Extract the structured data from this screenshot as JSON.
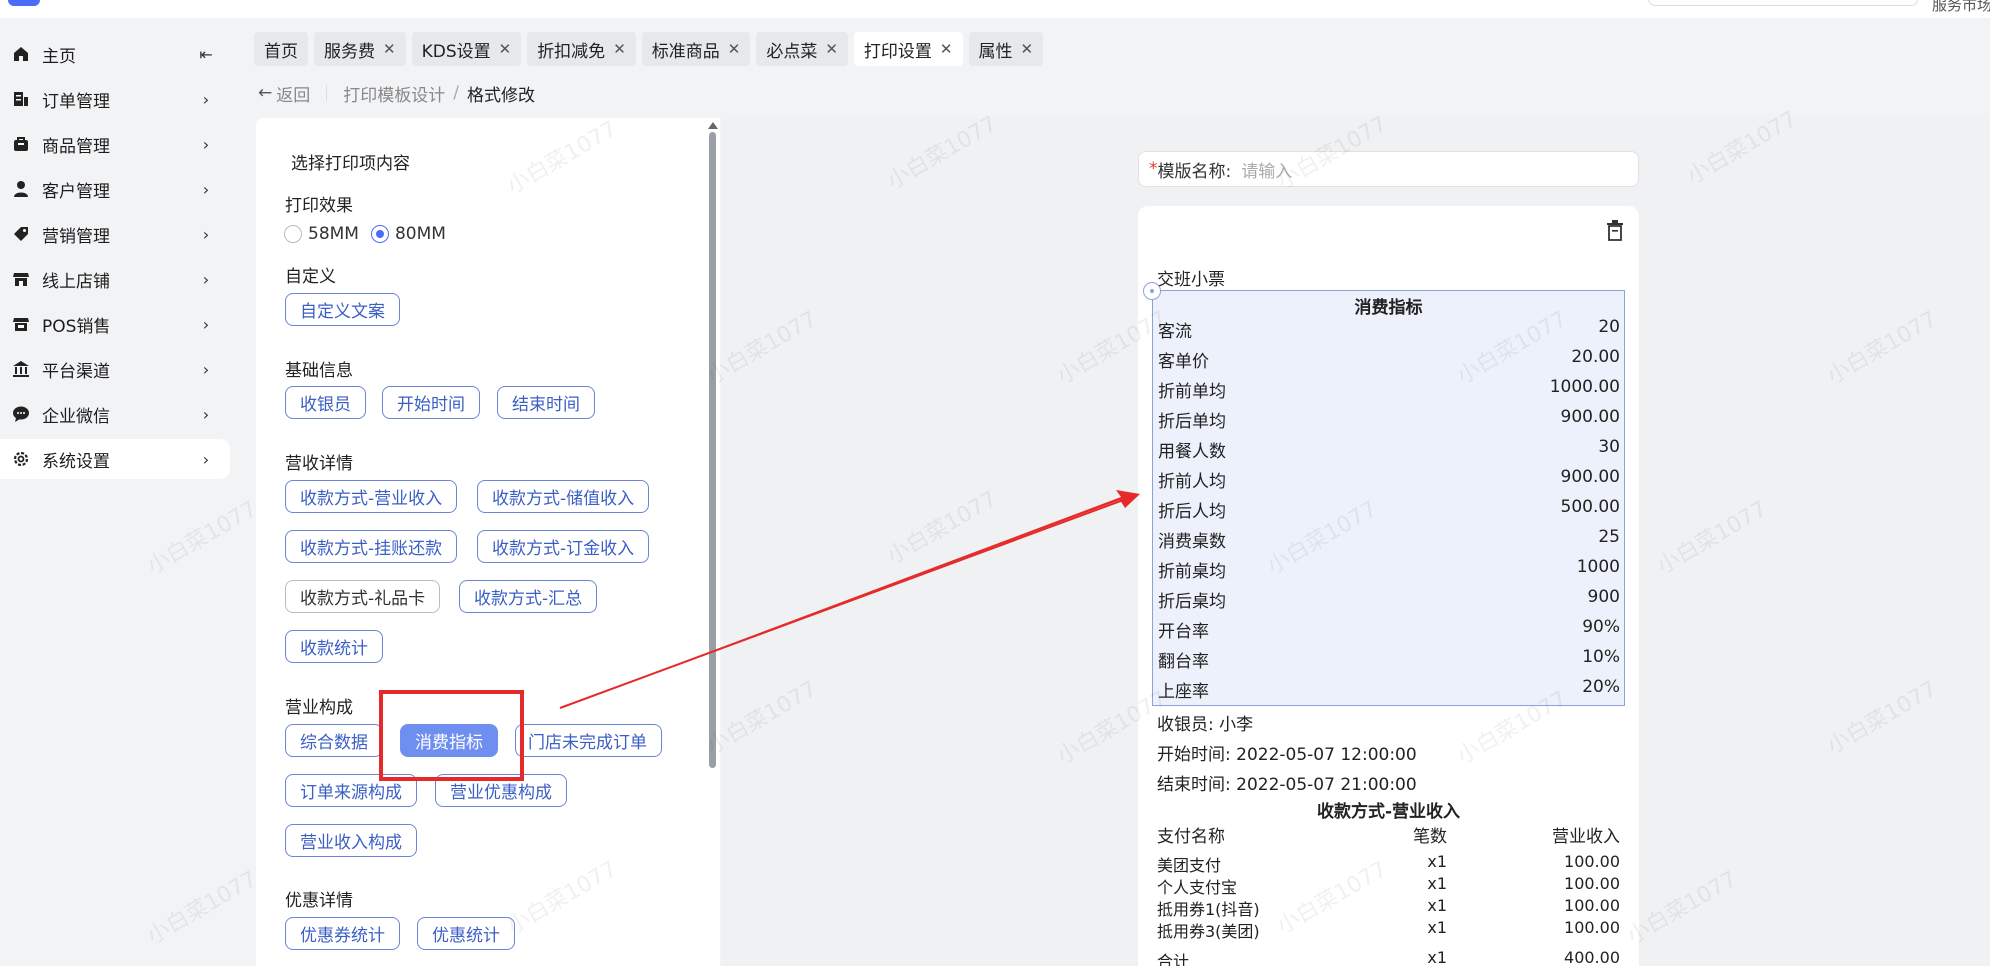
{
  "topbar": {
    "right_text": "服务市场"
  },
  "sidebar": {
    "items": [
      {
        "label": "主页",
        "icon": "home-icon"
      },
      {
        "label": "订单管理",
        "icon": "order-icon"
      },
      {
        "label": "商品管理",
        "icon": "bag-icon"
      },
      {
        "label": "客户管理",
        "icon": "user-icon"
      },
      {
        "label": "营销管理",
        "icon": "tag-icon"
      },
      {
        "label": "线上店铺",
        "icon": "store-icon"
      },
      {
        "label": "POS销售",
        "icon": "pos-icon"
      },
      {
        "label": "平台渠道",
        "icon": "bank-icon"
      },
      {
        "label": "企业微信",
        "icon": "chat-icon"
      },
      {
        "label": "系统设置",
        "icon": "gear-icon"
      }
    ],
    "collapse_icon": "collapse-icon"
  },
  "tabs": [
    {
      "label": "首页",
      "closable": false
    },
    {
      "label": "服务费",
      "closable": true
    },
    {
      "label": "KDS设置",
      "closable": true
    },
    {
      "label": "折扣减免",
      "closable": true
    },
    {
      "label": "标准商品",
      "closable": true
    },
    {
      "label": "必点菜",
      "closable": true
    },
    {
      "label": "打印设置",
      "closable": true,
      "active": true
    },
    {
      "label": "属性",
      "closable": true
    }
  ],
  "breadcrumb": {
    "back": "返回",
    "parent": "打印模板设计",
    "slash": "/",
    "current": "格式修改"
  },
  "panel": {
    "title": "选择打印项内容",
    "print_effect": {
      "label": "打印效果",
      "options": [
        "58MM",
        "80MM"
      ],
      "selected": "80MM"
    },
    "custom": {
      "label": "自定义",
      "buttons": [
        "自定义文案"
      ]
    },
    "basic": {
      "label": "基础信息",
      "buttons": [
        "收银员",
        "开始时间",
        "结束时间"
      ]
    },
    "revenue": {
      "label": "营收详情",
      "buttons": [
        "收款方式-营业收入",
        "收款方式-储值收入",
        "收款方式-挂账还款",
        "收款方式-订金收入",
        "收款方式-礼品卡",
        "收款方式-汇总",
        "收款统计"
      ]
    },
    "composition": {
      "label": "营业构成",
      "buttons": [
        "综合数据",
        "消费指标",
        "门店未完成订单",
        "订单来源构成",
        "营业优惠构成",
        "营业收入构成"
      ],
      "selected": "消费指标"
    },
    "discount": {
      "label": "优惠详情",
      "buttons": [
        "优惠券统计",
        "优惠统计"
      ]
    }
  },
  "template_name": {
    "required_mark": "*",
    "label": "模版名称:",
    "placeholder": "请输入"
  },
  "receipt": {
    "title": "交班小票",
    "metrics": {
      "heading": "消费指标",
      "rows": [
        {
          "name": "客流",
          "value": "20"
        },
        {
          "name": "客单价",
          "value": "20.00"
        },
        {
          "name": "折前单均",
          "value": "1000.00"
        },
        {
          "name": "折后单均",
          "value": "900.00"
        },
        {
          "name": "用餐人数",
          "value": "30"
        },
        {
          "name": "折前人均",
          "value": "900.00"
        },
        {
          "name": "折后人均",
          "value": "500.00"
        },
        {
          "name": "消费桌数",
          "value": "25"
        },
        {
          "name": "折前桌均",
          "value": "1000"
        },
        {
          "name": "折后桌均",
          "value": "900"
        },
        {
          "name": "开台率",
          "value": "90%"
        },
        {
          "name": "翻台率",
          "value": "10%"
        },
        {
          "name": "上座率",
          "value": "20%"
        }
      ]
    },
    "cashier": "收银员: 小李",
    "start_time": "开始时间: 2022-05-07 12:00:00",
    "end_time": "结束时间: 2022-05-07 21:00:00",
    "payment": {
      "heading": "收款方式-营业收入",
      "columns": [
        "支付名称",
        "笔数",
        "营业收入"
      ],
      "rows": [
        {
          "name": "美团支付",
          "count": "x1",
          "amount": "100.00"
        },
        {
          "name": "个人支付宝",
          "count": "x1",
          "amount": "100.00"
        },
        {
          "name": "抵用券1(抖音)",
          "count": "x1",
          "amount": "100.00"
        },
        {
          "name": "抵用券3(美团)",
          "count": "x1",
          "amount": "100.00"
        },
        {
          "name": "合计",
          "count": "x1",
          "amount": "400.00"
        }
      ]
    }
  },
  "watermark": "小白菜1077",
  "colors": {
    "accent": "#4a6cf7",
    "selected_button": "#6f8ff0",
    "highlight": "#e52a2a",
    "metric_bg": "#edf1fb"
  }
}
